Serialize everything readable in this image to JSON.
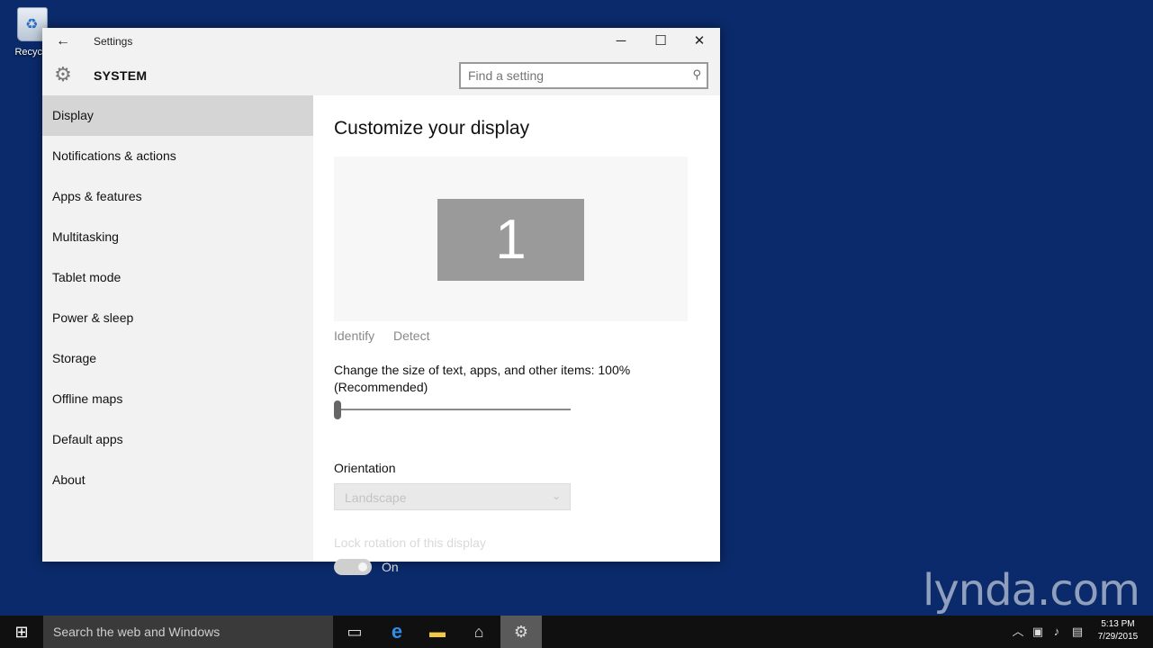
{
  "desktop": {
    "recycle_bin_label": "Recycle"
  },
  "window": {
    "title": "Settings",
    "back_icon": "back-arrow-icon",
    "controls": {
      "minimize": "─",
      "maximize": "☐",
      "close": "✕"
    },
    "section_title": "SYSTEM",
    "search": {
      "placeholder": "Find a setting",
      "value": ""
    }
  },
  "sidebar": {
    "items": [
      {
        "label": "Display",
        "active": true
      },
      {
        "label": "Notifications & actions"
      },
      {
        "label": "Apps & features"
      },
      {
        "label": "Multitasking"
      },
      {
        "label": "Tablet mode"
      },
      {
        "label": "Power & sleep"
      },
      {
        "label": "Storage"
      },
      {
        "label": "Offline maps"
      },
      {
        "label": "Default apps"
      },
      {
        "label": "About"
      }
    ]
  },
  "content": {
    "title": "Customize your display",
    "monitor_number": "1",
    "identify_label": "Identify",
    "detect_label": "Detect",
    "scale_label": "Change the size of text, apps, and other items: 100% (Recommended)",
    "scale_value_percent": 100,
    "orientation_label": "Orientation",
    "orientation_value": "Landscape",
    "lock_rotation_label": "Lock rotation of this display",
    "lock_rotation_state": "On"
  },
  "taskbar": {
    "search_placeholder": "Search the web and Windows",
    "time": "5:13 PM",
    "date": "7/29/2015"
  },
  "watermark": "lynda.com",
  "colors": {
    "desktop_bg": "#0b2a6b",
    "taskbar_bg": "#101010",
    "nav_active_bg": "#d5d5d5"
  }
}
